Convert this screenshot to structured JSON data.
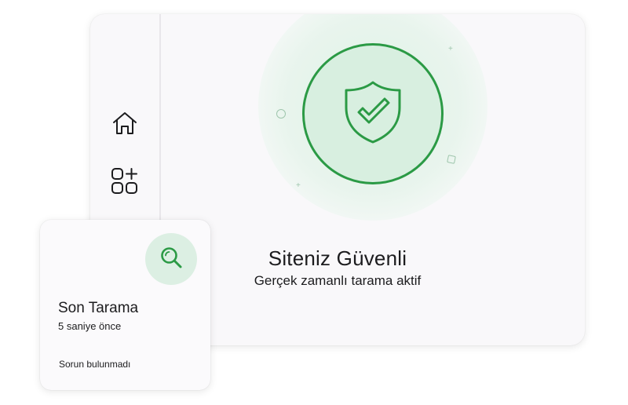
{
  "sidebar": {
    "items": [
      {
        "icon": "home-icon"
      },
      {
        "icon": "apps-add-icon"
      }
    ]
  },
  "status": {
    "icon": "shield-check-icon",
    "title": "Siteniz Güvenli",
    "subtitle": "Gerçek zamanlı tarama aktif",
    "accent_color": "#2b9a45",
    "glow_color": "#d8efe0"
  },
  "scan_card": {
    "icon": "search-icon",
    "title": "Son Tarama",
    "time": "5 saniye önce",
    "result": "Sorun bulunmadı"
  }
}
